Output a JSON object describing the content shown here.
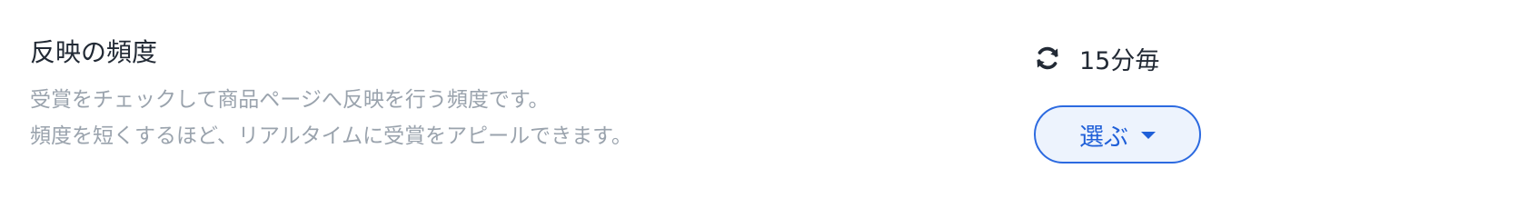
{
  "setting": {
    "title": "反映の頻度",
    "description_line1": "受賞をチェックして商品ページへ反映を行う頻度です。",
    "description_line2": "頻度を短くするほど、リアルタイムに受賞をアピールできます。",
    "current_value": "15分毎",
    "current_icon": "refresh-icon",
    "choose_label": "選ぶ",
    "choose_icon": "caret-down-icon"
  },
  "colors": {
    "title": "#222a35",
    "description": "#9aa3ad",
    "accent": "#1f5fd8",
    "button_bg": "#edf3fd"
  }
}
